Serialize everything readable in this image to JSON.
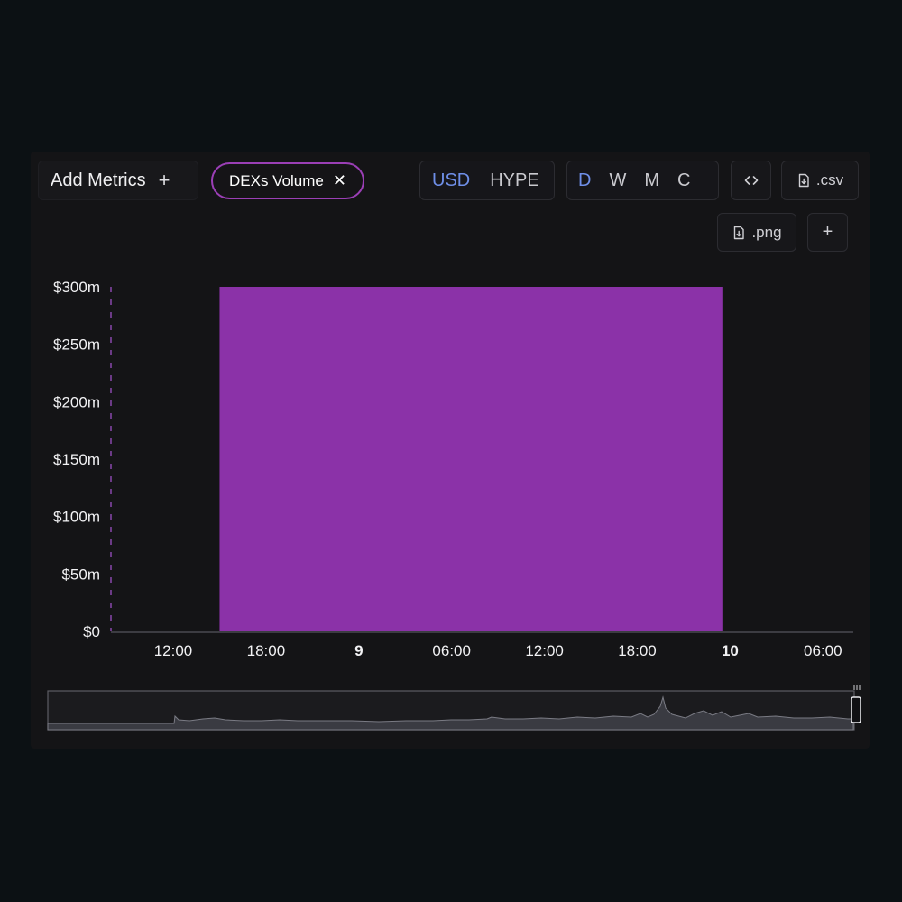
{
  "toolbar": {
    "add_metrics_label": "Add Metrics",
    "add_metrics_icon": "plus-icon",
    "metric_pill_label": "DEXs Volume",
    "metric_pill_icon": "close-icon",
    "metric_color": "#8b32a8",
    "currency_options": [
      "USD",
      "HYPE"
    ],
    "currency_selected": "USD",
    "period_options": [
      "D",
      "W",
      "M",
      "C"
    ],
    "period_selected": "D",
    "embed_icon": "code-icon",
    "csv_label": ".csv",
    "png_label": ".png",
    "download_icon": "file-download-icon",
    "more_label": "+",
    "accent_color": "#6f8fe8"
  },
  "chart_data": {
    "type": "bar",
    "series": [
      {
        "values": [
          300
        ]
      }
    ],
    "bar_x_range": [
      "15:00",
      "23:30"
    ],
    "y_ticks": [
      "$0",
      "$50m",
      "$100m",
      "$150m",
      "$200m",
      "$250m",
      "$300m"
    ],
    "ylim": [
      0,
      300
    ],
    "x_ticks": [
      {
        "label": "12:00",
        "bold": false
      },
      {
        "label": "18:00",
        "bold": false
      },
      {
        "label": "9",
        "bold": true
      },
      {
        "label": "06:00",
        "bold": false
      },
      {
        "label": "12:00",
        "bold": false
      },
      {
        "label": "18:00",
        "bold": false
      },
      {
        "label": "10",
        "bold": true
      },
      {
        "label": "06:00",
        "bold": false
      }
    ],
    "grid": false,
    "brush": {
      "has_overview": true
    }
  }
}
